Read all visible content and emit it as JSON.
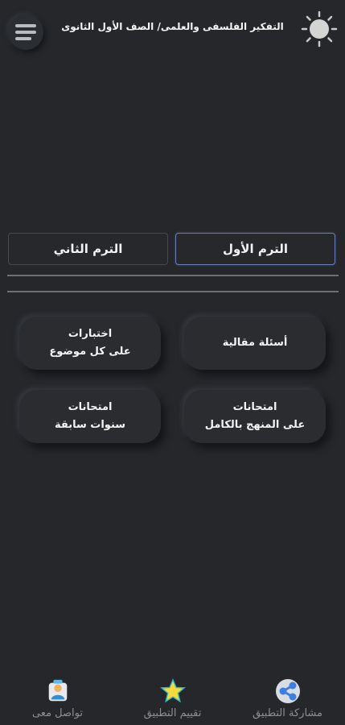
{
  "header": {
    "title": "التفكير الفلسفى والعلمى/ الصف الأول الثانوى",
    "theme_toggle_icon": "sun-icon",
    "menu_icon": "hamburger-menu-icon"
  },
  "terms": {
    "first": "الترم الأول",
    "second": "الترم الثاني",
    "selected": "first",
    "accent_color": "#6b7fbd"
  },
  "cards": [
    {
      "line1": "أسئلة مقالية",
      "line2": ""
    },
    {
      "line1": "اختبارات",
      "line2": "على كل موضوع"
    },
    {
      "line1": "امتحانات",
      "line2": "على المنهج بالكامل"
    },
    {
      "line1": "امتحانات",
      "line2": "سنوات سابقة"
    }
  ],
  "bottom_nav": [
    {
      "label": "مشاركة التطبيق",
      "icon": "share-icon"
    },
    {
      "label": "تقييم التطبيق",
      "icon": "star-icon"
    },
    {
      "label": "تواصل معى",
      "icon": "contact-icon"
    }
  ],
  "colors": {
    "background": "#25272b",
    "share_icon": "#3b7fe0",
    "star_icon": "#f6d93a"
  }
}
